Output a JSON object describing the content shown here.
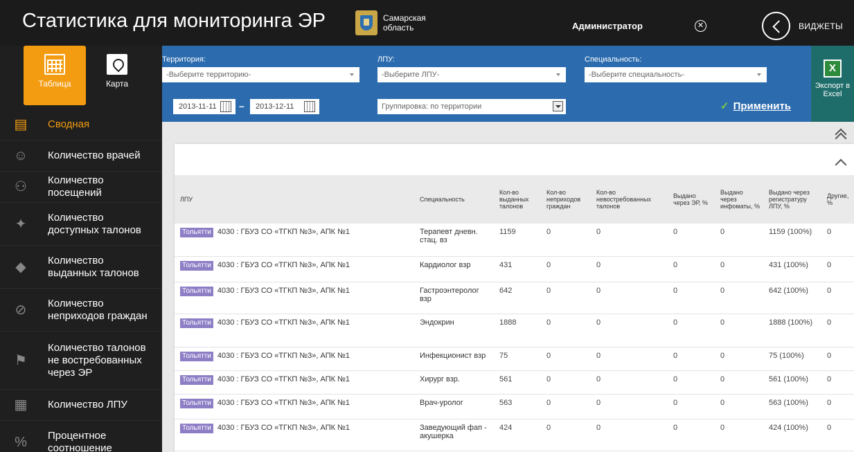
{
  "header": {
    "title": "Статистика для мониторинга ЭР",
    "region": "Самарская область",
    "user": "Администратор",
    "widgets_label": "ВИДЖЕТЫ"
  },
  "sidebar": {
    "views": [
      {
        "label": "Таблица",
        "icon": "table-icon"
      },
      {
        "label": "Карта",
        "icon": "map-icon"
      }
    ],
    "items": [
      {
        "label": "Сводная",
        "icon": "summary-icon"
      },
      {
        "label": "Количество врачей",
        "icon": "doctor-icon"
      },
      {
        "label": "Количество посещений",
        "icon": "visits-icon"
      },
      {
        "label": "Количество доступных талонов",
        "icon": "available-tickets-icon"
      },
      {
        "label": "Количество выданных талонов",
        "icon": "issued-tickets-icon"
      },
      {
        "label": "Количество неприходов граждан",
        "icon": "no-show-icon"
      },
      {
        "label": "Количество талонов не востребованных через ЭР",
        "icon": "unclaimed-icon"
      },
      {
        "label": "Количество ЛПУ",
        "icon": "hospital-icon"
      },
      {
        "label": "Процентное соотношение",
        "icon": "percent-icon"
      }
    ]
  },
  "filters": {
    "territory_label": "Территория:",
    "territory_value": "-Выберите территорию-",
    "lpu_label": "ЛПУ:",
    "lpu_value": "-Выберите ЛПУ-",
    "specialty_label": "Специальность:",
    "specialty_value": "-Выберите специальность-",
    "date_from": "2013-11-11",
    "date_to": "2013-12-11",
    "date_separator": "–",
    "grouping": "Группировка: по территории",
    "apply": "Применить",
    "apply_check": "✓"
  },
  "export": {
    "label": "Экспорт в Excel",
    "icon_letter": "X"
  },
  "table": {
    "columns": [
      "ЛПУ",
      "Специальность",
      "Кол-во выданных талонов",
      "Кол-во неприходов граждан",
      "Кол-во невостребованных талонов",
      "Выдано через ЭР, %",
      "Выдано через инфоматы, %",
      "Выдано через регистратуру ЛПУ, %",
      "Другие, %"
    ],
    "rows": [
      {
        "city": "Тольятти",
        "lpu": "4030 : ГБУЗ СО «ТГКП №3», АПК №1",
        "specialty": "Терапевт дневн. стац. вз",
        "issued": "1159",
        "noshow": "0",
        "unclaimed": "0",
        "er": "0",
        "infomat": "0",
        "registry": "1159 (100%)",
        "other": "0"
      },
      {
        "city": "Тольятти",
        "lpu": "4030 : ГБУЗ СО «ТГКП №3», АПК №1",
        "specialty": "Кардиолог взр",
        "issued": "431",
        "noshow": "0",
        "unclaimed": "0",
        "er": "0",
        "infomat": "0",
        "registry": "431 (100%)",
        "other": "0"
      },
      {
        "city": "Тольятти",
        "lpu": "4030 : ГБУЗ СО «ТГКП №3», АПК №1",
        "specialty": "Гастроэнтеролог взр",
        "issued": "642",
        "noshow": "0",
        "unclaimed": "0",
        "er": "0",
        "infomat": "0",
        "registry": "642 (100%)",
        "other": "0"
      },
      {
        "city": "Тольятти",
        "lpu": "4030 : ГБУЗ СО «ТГКП №3», АПК №1",
        "specialty": "Эндокрин",
        "issued": "1888",
        "noshow": "0",
        "unclaimed": "0",
        "er": "0",
        "infomat": "0",
        "registry": "1888 (100%)",
        "other": "0"
      },
      {
        "city": "Тольятти",
        "lpu": "4030 : ГБУЗ СО «ТГКП №3», АПК №1",
        "specialty": "Инфекционист взр",
        "issued": "75",
        "noshow": "0",
        "unclaimed": "0",
        "er": "0",
        "infomat": "0",
        "registry": "75 (100%)",
        "other": "0"
      },
      {
        "city": "Тольятти",
        "lpu": "4030 : ГБУЗ СО «ТГКП №3», АПК №1",
        "specialty": "Хирург взр.",
        "issued": "561",
        "noshow": "0",
        "unclaimed": "0",
        "er": "0",
        "infomat": "0",
        "registry": "561 (100%)",
        "other": "0"
      },
      {
        "city": "Тольятти",
        "lpu": "4030 : ГБУЗ СО «ТГКП №3», АПК №1",
        "specialty": "Врач-уролог",
        "issued": "563",
        "noshow": "0",
        "unclaimed": "0",
        "er": "0",
        "infomat": "0",
        "registry": "563 (100%)",
        "other": "0"
      },
      {
        "city": "Тольятти",
        "lpu": "4030 : ГБУЗ СО «ТГКП №3», АПК №1",
        "specialty": "Заведующий фап - акушерка",
        "issued": "424",
        "noshow": "0",
        "unclaimed": "0",
        "er": "0",
        "infomat": "0",
        "registry": "424 (100%)",
        "other": "0"
      }
    ]
  },
  "colors": {
    "accent": "#f39c12",
    "filter_bar": "#2c6cae",
    "excel": "#1f6d6b",
    "city_badge": "#8d7ec6"
  }
}
